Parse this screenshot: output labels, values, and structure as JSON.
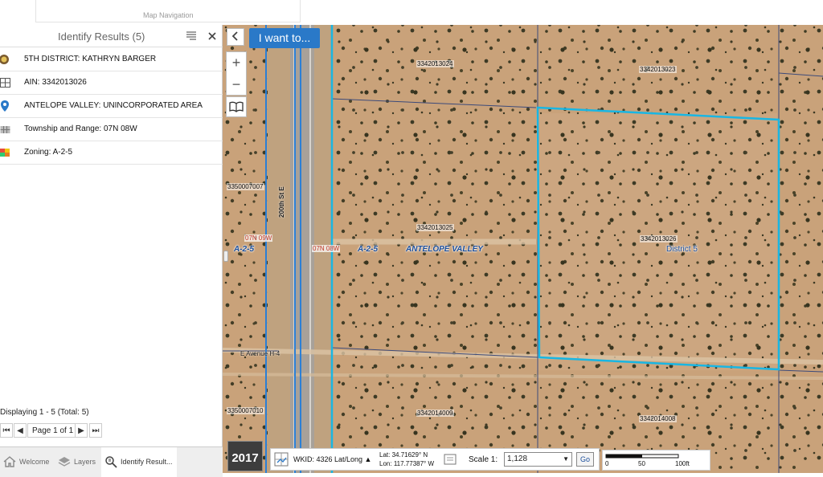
{
  "header": {
    "map_navigation_label": "Map Navigation"
  },
  "panel": {
    "title": "Identify Results (5)",
    "results": [
      {
        "icon": "district-seal-icon",
        "label": "5TH DISTRICT: KATHRYN BARGER"
      },
      {
        "icon": "parcel-grid-icon",
        "label": "AIN: 3342013026"
      },
      {
        "icon": "location-pin-icon",
        "label": "ANTELOPE VALLEY: UNINCORPORATED AREA"
      },
      {
        "icon": "township-icon",
        "label": "Township and Range: 07N 08W"
      },
      {
        "icon": "zoning-icon",
        "label": "Zoning: A-2-5"
      }
    ],
    "display_count": "Displaying 1 - 5 (Total: 5)",
    "pager_label": "Page 1 of 1",
    "tabs": [
      {
        "icon": "home-icon",
        "label": "Welcome"
      },
      {
        "icon": "layers-icon",
        "label": "Layers"
      },
      {
        "icon": "identify-icon",
        "label": "Identify Result..."
      }
    ]
  },
  "map": {
    "i_want_to": "I want to...",
    "parcels": {
      "p1": "3342013024",
      "p2": "3342013023",
      "p3": "3350007007",
      "p4": "3342013025",
      "p5": "3342013026",
      "p6": "3350007010",
      "p7": "3342014009",
      "p8": "3342014008"
    },
    "zoning_left": "A-2-5",
    "zoning_center": "A-2-5",
    "area_name": "ANTELOPE VALLEY",
    "district_label": "District 5",
    "township_left": "07N 09W",
    "township_center": "07N 08W",
    "road_vertical": "200th St E",
    "road_horizontal": "E Avenue H-4",
    "selected_parcel_color": "#19b6e3",
    "road_line_color": "#2a7fd6"
  },
  "statusbar": {
    "year": "2017",
    "wkid": "WKID: 4326 Lat/Long ▲",
    "lat_label": "Lat:",
    "lat_value": "34.71629° N",
    "lon_label": "Lon:",
    "lon_value": "117.77387° W",
    "scale_label": "Scale 1:",
    "scale_value": "1,128",
    "go_label": "Go",
    "scalebar_ticks": [
      "0",
      "50",
      "100ft"
    ]
  }
}
